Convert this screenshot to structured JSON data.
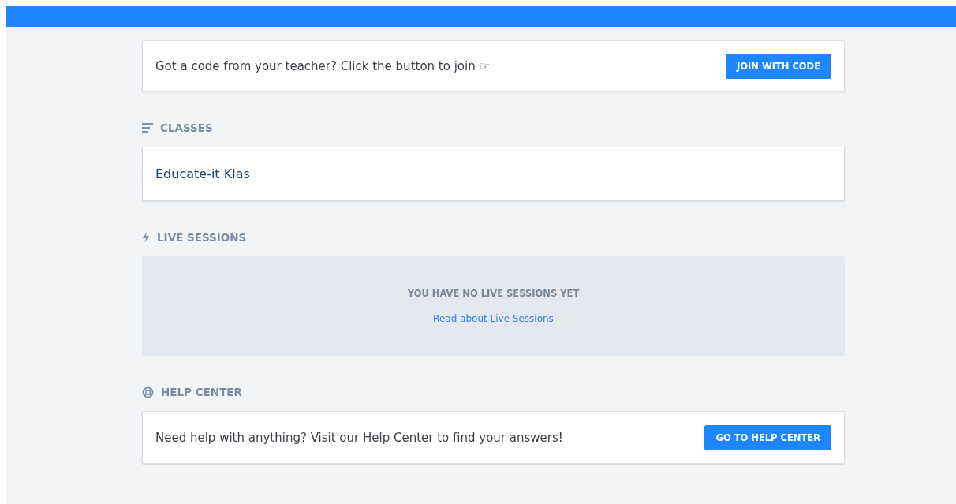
{
  "join_card": {
    "text": "Got a code from your teacher? Click the button to join ☞",
    "button": "JOIN WITH CODE"
  },
  "classes": {
    "heading": "CLASSES",
    "items": [
      {
        "name": "Educate-it Klas"
      }
    ]
  },
  "live_sessions": {
    "heading": "LIVE SESSIONS",
    "empty_text": "YOU HAVE NO LIVE SESSIONS YET",
    "link": "Read about Live Sessions"
  },
  "help_center": {
    "heading": "HELP CENTER",
    "text": "Need help with anything? Visit our Help Center to find your answers!",
    "button": "GO TO HELP CENTER"
  }
}
